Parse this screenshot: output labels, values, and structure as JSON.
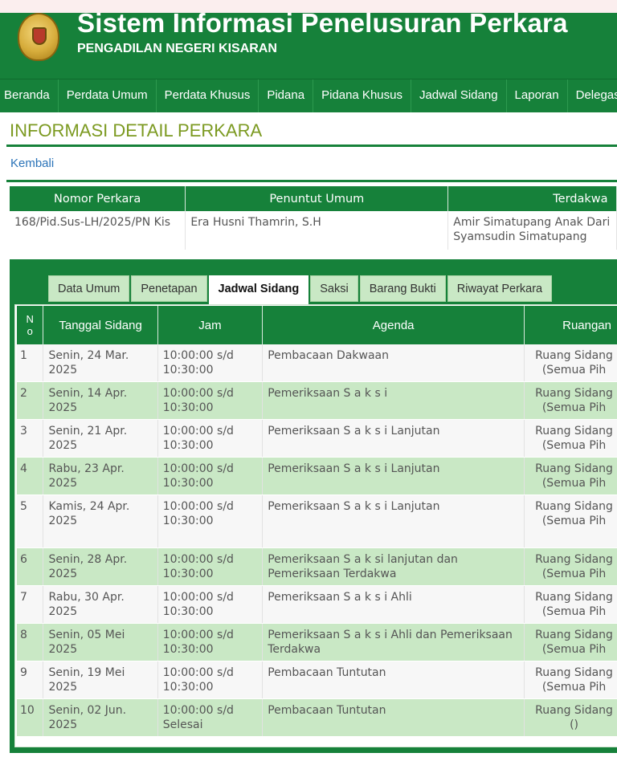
{
  "header": {
    "title": "Sistem Informasi Penelusuran Perkara",
    "subtitle": "PENGADILAN NEGERI KISARAN"
  },
  "nav": [
    "Beranda",
    "Perdata Umum",
    "Perdata Khusus",
    "Pidana",
    "Pidana Khusus",
    "Jadwal Sidang",
    "Laporan",
    "Delegasi"
  ],
  "page": {
    "title": "INFORMASI DETAIL PERKARA",
    "back_link": "Kembali"
  },
  "case": {
    "headers": [
      "Nomor Perkara",
      "Penuntut Umum",
      "Terdakwa"
    ],
    "nomor_perkara": "168/Pid.Sus-LH/2025/PN Kis",
    "penuntut_umum": "Era Husni Thamrin, S.H",
    "terdakwa": "Amir Simatupang Anak Dari Syamsudin Simatupang"
  },
  "tabs": [
    {
      "label": "Data Umum",
      "active": false
    },
    {
      "label": "Penetapan",
      "active": false
    },
    {
      "label": "Jadwal Sidang",
      "active": true
    },
    {
      "label": "Saksi",
      "active": false
    },
    {
      "label": "Barang Bukti",
      "active": false
    },
    {
      "label": "Riwayat Perkara",
      "active": false
    }
  ],
  "schedule": {
    "headers": {
      "no": "No",
      "tanggal": "Tanggal Sidang",
      "jam": "Jam",
      "agenda": "Agenda",
      "ruangan": "Ruangan"
    },
    "rows": [
      {
        "no": "1",
        "tanggal": "Senin, 24 Mar. 2025",
        "jam": "10:00:00 s/d 10:30:00",
        "agenda": "Pembacaan Dakwaan",
        "ruangan_line1": "Ruang Sidang",
        "ruangan_line2": "(Semua Pih"
      },
      {
        "no": "2",
        "tanggal": "Senin, 14 Apr. 2025",
        "jam": "10:00:00 s/d 10:30:00",
        "agenda": "Pemeriksaan S a k s i",
        "ruangan_line1": "Ruang Sidang",
        "ruangan_line2": "(Semua Pih"
      },
      {
        "no": "3",
        "tanggal": "Senin, 21 Apr. 2025",
        "jam": "10:00:00 s/d 10:30:00",
        "agenda": "Pemeriksaan S a k s i Lanjutan",
        "ruangan_line1": "Ruang Sidang",
        "ruangan_line2": "(Semua Pih"
      },
      {
        "no": "4",
        "tanggal": "Rabu, 23 Apr. 2025",
        "jam": "10:00:00 s/d 10:30:00",
        "agenda": "Pemeriksaan S a k s i Lanjutan",
        "ruangan_line1": "Ruang Sidang",
        "ruangan_line2": "(Semua Pih"
      },
      {
        "no": "5",
        "tanggal": "Kamis, 24 Apr. 2025",
        "jam": "10:00:00 s/d 10:30:00",
        "agenda": "Pemeriksaan S a k s i Lanjutan",
        "ruangan_line1": "Ruang Sidang",
        "ruangan_line2": "(Semua Pih"
      },
      {
        "no": "6",
        "tanggal": "Senin, 28 Apr. 2025",
        "jam": "10:00:00 s/d 10:30:00",
        "agenda": "Pemeriksaan S a k si lanjutan dan Pemeriksaan Terdakwa",
        "ruangan_line1": "Ruang Sidang",
        "ruangan_line2": "(Semua Pih"
      },
      {
        "no": "7",
        "tanggal": "Rabu, 30 Apr. 2025",
        "jam": "10:00:00 s/d 10:30:00",
        "agenda": "Pemeriksaan S a k s i Ahli",
        "ruangan_line1": "Ruang Sidang",
        "ruangan_line2": "(Semua Pih"
      },
      {
        "no": "8",
        "tanggal": "Senin, 05 Mei 2025",
        "jam": "10:00:00 s/d 10:30:00",
        "agenda": "Pemeriksaan S a k s i Ahli dan Pemeriksaan Terdakwa",
        "ruangan_line1": "Ruang Sidang",
        "ruangan_line2": "(Semua Pih"
      },
      {
        "no": "9",
        "tanggal": "Senin, 19 Mei 2025",
        "jam": "10:00:00 s/d 10:30:00",
        "agenda": "Pembacaan Tuntutan",
        "ruangan_line1": "Ruang Sidang",
        "ruangan_line2": "(Semua Pih"
      },
      {
        "no": "10",
        "tanggal": "Senin, 02 Jun. 2025",
        "jam": "10:00:00 s/d Selesai",
        "agenda": "Pembacaan Tuntutan",
        "ruangan_line1": "Ruang Sidang",
        "ruangan_line2": "()"
      }
    ]
  },
  "colors": {
    "brand_green": "#16813a",
    "row_green": "#c9e8c5",
    "title_olive": "#7c9a21",
    "link_blue": "#2a73b8"
  }
}
